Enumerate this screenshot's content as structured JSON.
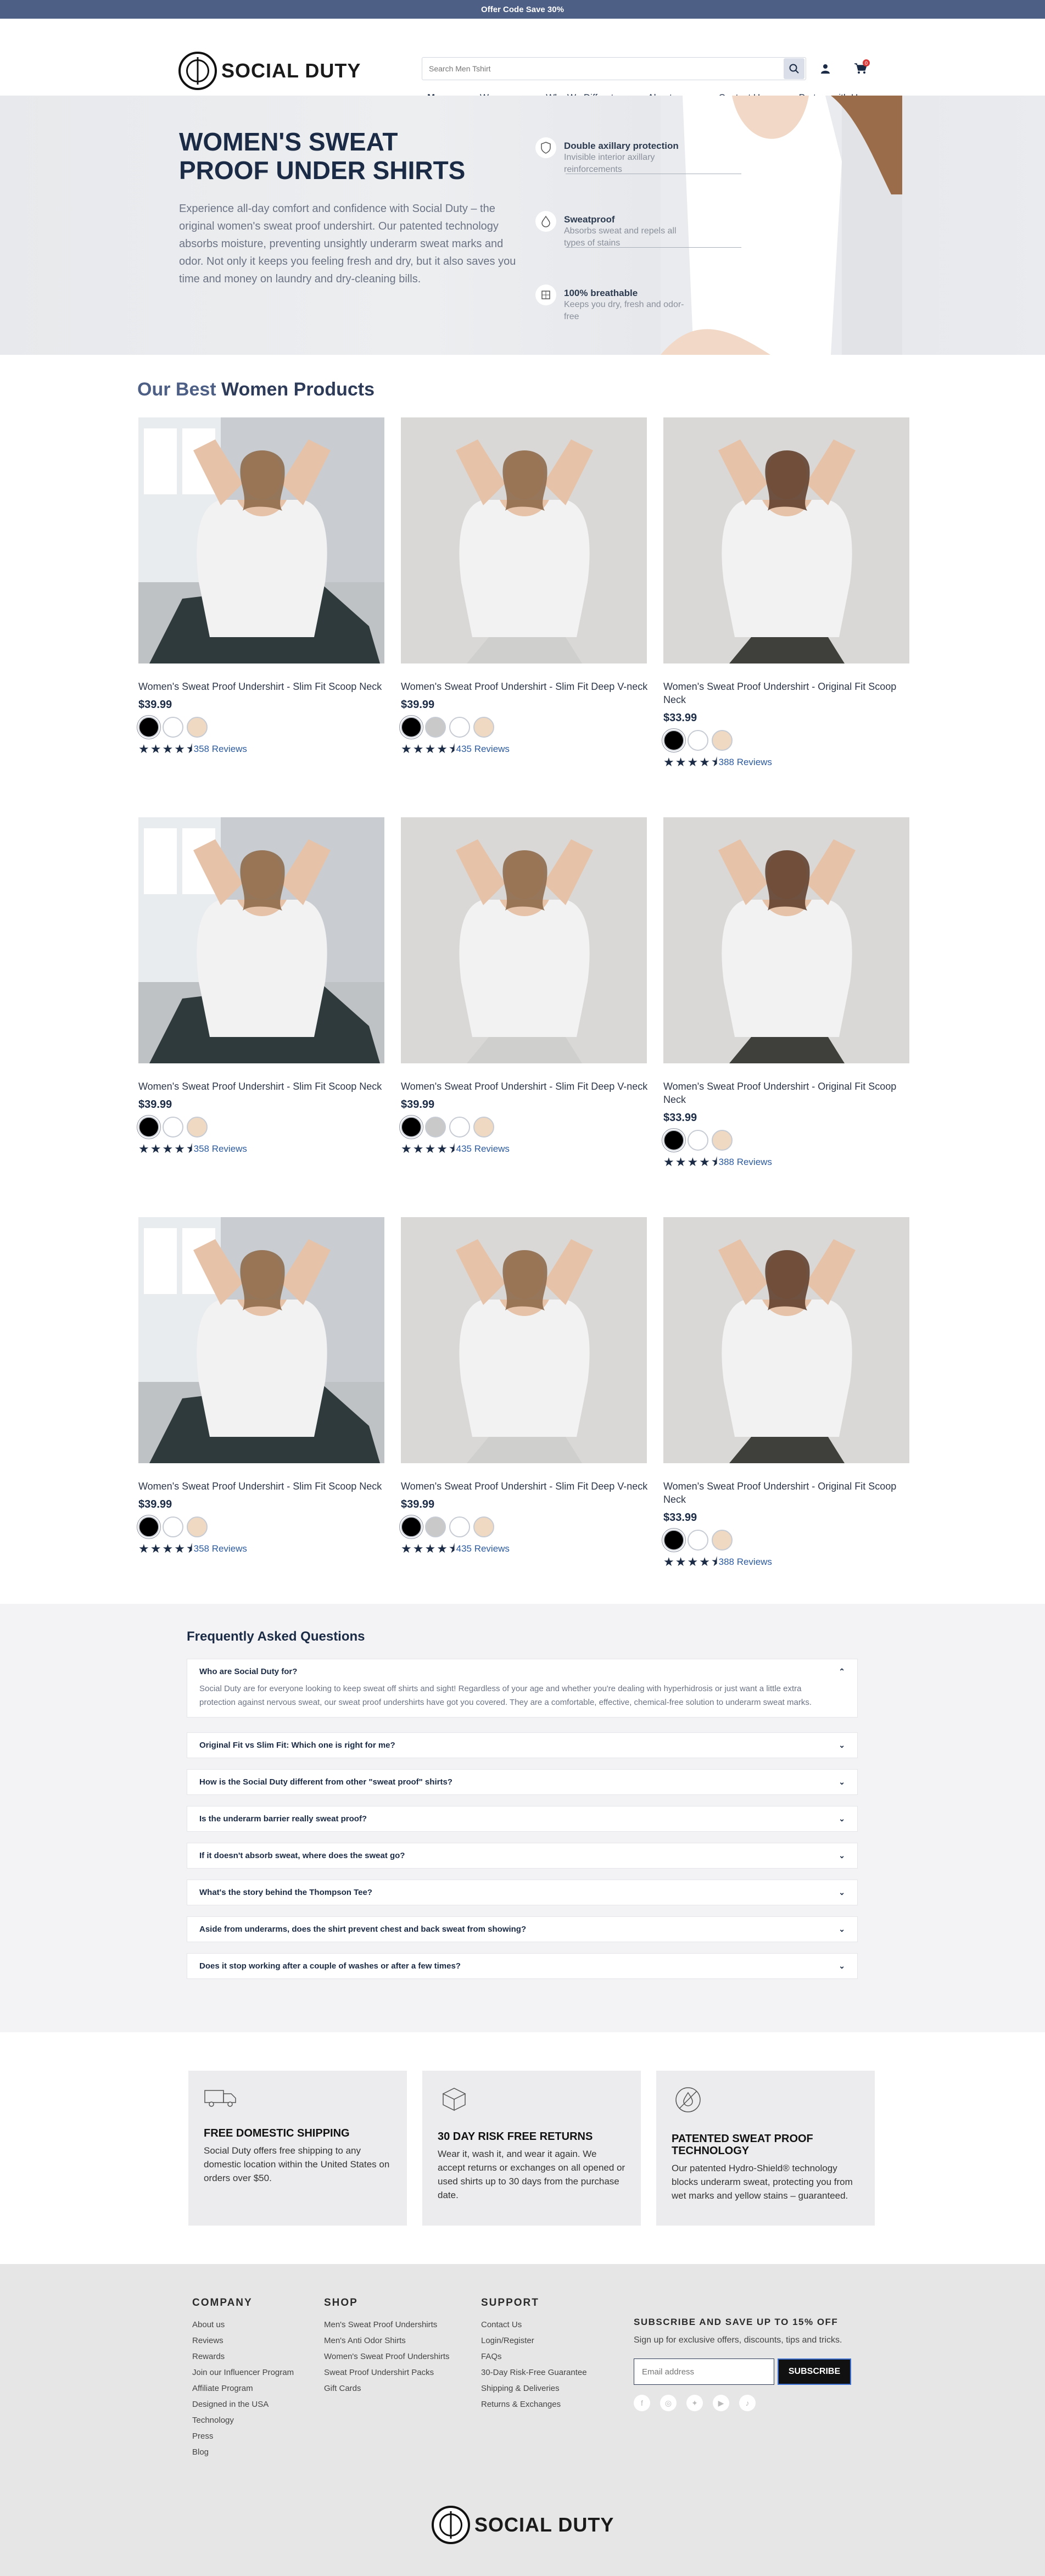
{
  "announcement": "Offer Code Save 30%",
  "brand": {
    "name": "SOCIAL DUTY"
  },
  "search": {
    "placeholder": "Search Men Tshirt"
  },
  "cart": {
    "count": "0"
  },
  "nav": [
    "Men",
    "Women",
    "Why We Diffrent",
    "About us",
    "Contact Us",
    "Partner with Us"
  ],
  "hero": {
    "title": "WOMEN'S SWEAT PROOF UNDER SHIRTS",
    "body": "Experience all-day comfort and confidence with Social Duty – the original women's sweat proof undershirt. Our patented technology absorbs moisture, preventing unsightly underarm sweat marks and odor. Not only it keeps you feeling fresh and dry, but it also saves you time and money on laundry and dry-cleaning bills.",
    "features": [
      {
        "title": "Double axillary protection",
        "text": "Invisible interior axillary reinforcements",
        "icon": "shield-icon"
      },
      {
        "title": "Sweatproof",
        "text": "Absorbs sweat and repels all types of stains",
        "icon": "drop-icon"
      },
      {
        "title": "100% breathable",
        "text": "Keeps you dry, fresh and odor-free",
        "icon": "fabric-icon"
      }
    ]
  },
  "products_heading": {
    "light": "Our Best",
    "bold": "Women Products"
  },
  "products": [
    {
      "name": "Women's Sweat Proof Undershirt - Slim Fit Scoop Neck",
      "price": "$39.99",
      "reviews": "358 Reviews",
      "rating": 4.5,
      "swatches": [
        "#000000",
        "#ffffff",
        "#efd9c2"
      ],
      "photo": "scoop"
    },
    {
      "name": "Women's Sweat Proof Undershirt - Slim Fit Deep V-neck",
      "price": "$39.99",
      "reviews": "435 Reviews",
      "rating": 4.5,
      "swatches": [
        "#000000",
        "#c9c9c9",
        "#ffffff",
        "#efd9c2"
      ],
      "photo": "vneck"
    },
    {
      "name": "Women's Sweat Proof Undershirt - Original Fit Scoop Neck",
      "price": "$33.99",
      "reviews": "388 Reviews",
      "rating": 4.5,
      "swatches": [
        "#000000",
        "#ffffff",
        "#efd9c2"
      ],
      "photo": "original"
    },
    {
      "name": "Women's Sweat Proof Undershirt - Slim Fit Scoop Neck",
      "price": "$39.99",
      "reviews": "358 Reviews",
      "rating": 4.5,
      "swatches": [
        "#000000",
        "#ffffff",
        "#efd9c2"
      ],
      "photo": "scoop"
    },
    {
      "name": "Women's Sweat Proof Undershirt - Slim Fit Deep V-neck",
      "price": "$39.99",
      "reviews": "435 Reviews",
      "rating": 4.5,
      "swatches": [
        "#000000",
        "#c9c9c9",
        "#ffffff",
        "#efd9c2"
      ],
      "photo": "vneck"
    },
    {
      "name": "Women's Sweat Proof Undershirt - Original Fit Scoop Neck",
      "price": "$33.99",
      "reviews": "388 Reviews",
      "rating": 4.5,
      "swatches": [
        "#000000",
        "#ffffff",
        "#efd9c2"
      ],
      "photo": "original"
    },
    {
      "name": "Women's Sweat Proof Undershirt - Slim Fit Scoop Neck",
      "price": "$39.99",
      "reviews": "358 Reviews",
      "rating": 4.5,
      "swatches": [
        "#000000",
        "#ffffff",
        "#efd9c2"
      ],
      "photo": "scoop"
    },
    {
      "name": "Women's Sweat Proof Undershirt - Slim Fit Deep V-neck",
      "price": "$39.99",
      "reviews": "435 Reviews",
      "rating": 4.5,
      "swatches": [
        "#000000",
        "#c9c9c9",
        "#ffffff",
        "#efd9c2"
      ],
      "photo": "vneck"
    },
    {
      "name": "Women's Sweat Proof Undershirt - Original Fit Scoop Neck",
      "price": "$33.99",
      "reviews": "388 Reviews",
      "rating": 4.5,
      "swatches": [
        "#000000",
        "#ffffff",
        "#efd9c2"
      ],
      "photo": "original"
    }
  ],
  "faq": {
    "title": "Frequently Asked Questions",
    "items": [
      {
        "q": "Who are Social Duty for?",
        "a": "Social Duty are for everyone looking to keep sweat off shirts and sight! Regardless of your age and whether you're dealing with hyperhidrosis or just want a little extra protection against nervous sweat, our sweat proof undershirts have got you covered. They are a comfortable, effective, chemical-free solution to underarm sweat marks.",
        "open": true
      },
      {
        "q": "Original Fit vs Slim Fit: Which one is right for me?"
      },
      {
        "q": "How is the Social Duty different from other \"sweat proof\" shirts?"
      },
      {
        "q": "Is the underarm barrier really sweat proof?"
      },
      {
        "q": "If it doesn't absorb sweat, where does the sweat go?"
      },
      {
        "q": "What's the story behind the Thompson Tee?"
      },
      {
        "q": "Aside from underarms, does the shirt prevent chest and back sweat from showing?"
      },
      {
        "q": "Does it stop working after a couple of washes or after a few times?"
      }
    ]
  },
  "promos": [
    {
      "title": "FREE DOMESTIC SHIPPING",
      "text": "Social Duty offers free shipping to any domestic location within the United States on orders over $50.",
      "icon": "truck-icon"
    },
    {
      "title": "30 DAY RISK FREE RETURNS",
      "text": "Wear it, wash it, and wear it again. We accept returns or exchanges on all opened or used shirts up to 30 days from the purchase date.",
      "icon": "box-icon"
    },
    {
      "title": "PATENTED SWEAT PROOF TECHNOLOGY",
      "text": "Our patented Hydro-Shield® technology blocks underarm sweat, protecting you from wet marks and yellow stains – guaranteed.",
      "icon": "no-sweat-icon"
    }
  ],
  "footer": {
    "company": {
      "title": "COMPANY",
      "links": [
        "About us",
        "Reviews",
        "Rewards",
        "Join our Influencer Program",
        "Affiliate Program",
        "Designed in the USA",
        "Technology",
        "Press",
        "Blog"
      ]
    },
    "shop": {
      "title": "SHOP",
      "links": [
        "Men's Sweat Proof Undershirts",
        "Men's Anti Odor Shirts",
        "Women's Sweat Proof Undershirts",
        "Sweat Proof Undershirt Packs",
        "Gift Cards"
      ]
    },
    "support": {
      "title": "SUPPORT",
      "links": [
        "Contact Us",
        "Login/Register",
        "FAQs",
        "30-Day Risk-Free Guarantee",
        "Shipping & Deliveries",
        "Returns & Exchanges"
      ]
    },
    "subscribe": {
      "title": "SUBSCRIBE AND SAVE UP TO 15% OFF",
      "text": "Sign up for exclusive offers, discounts, tips and tricks.",
      "placeholder": "Email address",
      "button": "SUBSCRIBE"
    },
    "socials": [
      "facebook-icon",
      "instagram-icon",
      "twitter-icon",
      "youtube-icon",
      "tiktok-icon"
    ]
  }
}
